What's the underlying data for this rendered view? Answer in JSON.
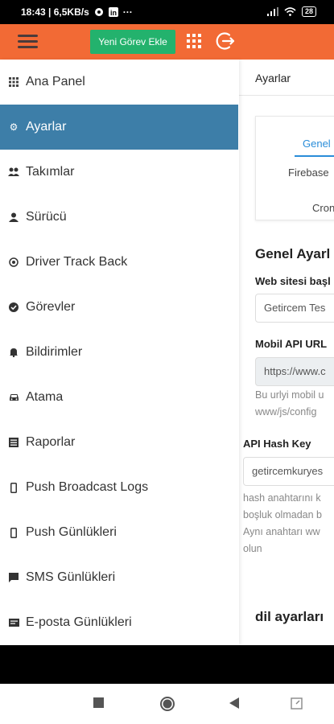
{
  "status_bar": {
    "time_info": "18:43 | 6,5KB/s",
    "dots": "···",
    "battery": "28"
  },
  "toolbar": {
    "add_task_label": "Yeni Görev Ekle"
  },
  "sidebar": {
    "items": [
      {
        "label": "Ana Panel",
        "icon": "dashboard-icon"
      },
      {
        "label": "Ayarlar",
        "icon": "gear-icon"
      },
      {
        "label": "Takımlar",
        "icon": "users-icon"
      },
      {
        "label": "Sürücü",
        "icon": "driver-icon"
      },
      {
        "label": "Driver Track Back",
        "icon": "target-icon"
      },
      {
        "label": "Görevler",
        "icon": "check-circle-icon"
      },
      {
        "label": "Bildirimler",
        "icon": "bell-icon"
      },
      {
        "label": "Atama",
        "icon": "car-icon"
      },
      {
        "label": "Raporlar",
        "icon": "report-icon"
      },
      {
        "label": "Push Broadcast Logs",
        "icon": "mobile-icon"
      },
      {
        "label": "Push Günlükleri",
        "icon": "mobile-icon"
      },
      {
        "label": "SMS Günlükleri",
        "icon": "message-icon"
      },
      {
        "label": "E-posta Günlükleri",
        "icon": "envelope-icon"
      }
    ],
    "active_index": 1
  },
  "content": {
    "page_title": "Ayarlar",
    "tabs": [
      "Genel",
      "Firebase",
      "Cron"
    ],
    "section_title": "Genel Ayarl",
    "web_title_label": "Web sitesi başl",
    "web_title_value": "Getircem Tes",
    "mobile_api_label": "Mobil API URL",
    "mobile_api_value": "https://www.c",
    "mobile_api_help_1": "Bu urlyi mobil u",
    "mobile_api_help_2": "www/js/config",
    "api_hash_label": "API Hash Key",
    "api_hash_value": "getircemkuryes",
    "api_hash_help_1": "hash anahtarını k",
    "api_hash_help_2": "boşluk olmadan b",
    "api_hash_help_3": "Aynı anahtarı ww",
    "api_hash_help_4": "olun",
    "lang_section_title": "dil ayarları"
  },
  "colors": {
    "topbar": "#f26a35",
    "add_button": "#23b26d",
    "active_nav": "#3d7ea8",
    "tab_active": "#2a8dd9"
  }
}
